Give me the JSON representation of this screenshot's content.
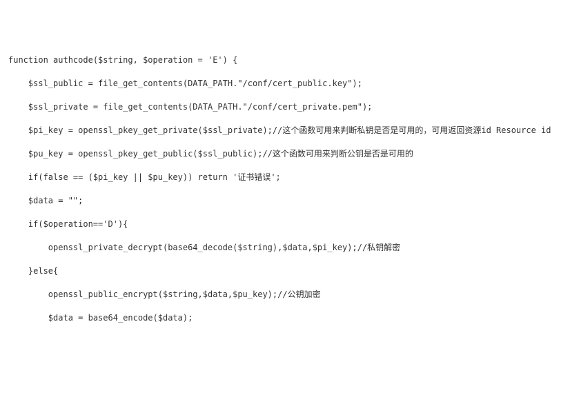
{
  "code": {
    "lines": [
      "function authcode($string, $operation = 'E') {",
      "",
      "    $ssl_public = file_get_contents(DATA_PATH.\"/conf/cert_public.key\");",
      "",
      "    $ssl_private = file_get_contents(DATA_PATH.\"/conf/cert_private.pem\");",
      "",
      "    $pi_key = openssl_pkey_get_private($ssl_private);//这个函数可用来判断私钥是否是可用的，可用返回资源id Resource id",
      "",
      "    $pu_key = openssl_pkey_get_public($ssl_public);//这个函数可用来判断公钥是否是可用的",
      "",
      "    if(false == ($pi_key || $pu_key)) return '证书错误';",
      "",
      "    $data = \"\";",
      "",
      "    if($operation=='D'){",
      "",
      "        openssl_private_decrypt(base64_decode($string),$data,$pi_key);//私钥解密",
      "",
      "    }else{",
      "",
      "        openssl_public_encrypt($string,$data,$pu_key);//公钥加密",
      "",
      "        $data = base64_encode($data);"
    ]
  }
}
